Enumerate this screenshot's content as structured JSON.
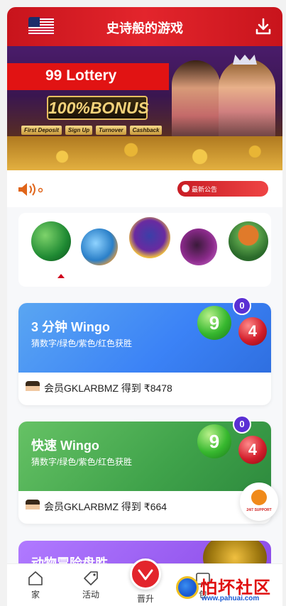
{
  "header": {
    "title": "史诗般的游戏"
  },
  "banner": {
    "lottery": "99 Lottery",
    "bonus": "100%BONUS",
    "tags": [
      "First Deposit",
      "Sign Up",
      "Turnover",
      "Cashback"
    ]
  },
  "notice": {
    "label": "最新公告"
  },
  "games": [
    {
      "title": "3 分钟 Wingo",
      "subtitle": "猜数字/绿色/紫色/红色获胜",
      "badge": "0",
      "ball_green": "9",
      "ball_red": "4",
      "winner": "会员GKLARBMZ 得到 ₹8478"
    },
    {
      "title": "快速 Wingo",
      "subtitle": "猜数字/绿色/紫色/红色获胜",
      "badge": "0",
      "ball_green": "9",
      "ball_red": "4",
      "winner": "会员GKLARBMZ 得到 ₹664"
    },
    {
      "title": "动物冒险盘胜"
    }
  ],
  "support": {
    "label": "24/7 SUPPORT"
  },
  "nav": {
    "home": "家",
    "activity": "活动",
    "promote": "晋升",
    "wallet": "包"
  },
  "watermark": {
    "name": "怕坏社区",
    "url": "www.pahuai.com"
  },
  "colors": {
    "primary": "#e3252c",
    "wingo3": "#3b82f6",
    "fastWingo": "#3fa24a",
    "badge": "#5a2fd4"
  }
}
